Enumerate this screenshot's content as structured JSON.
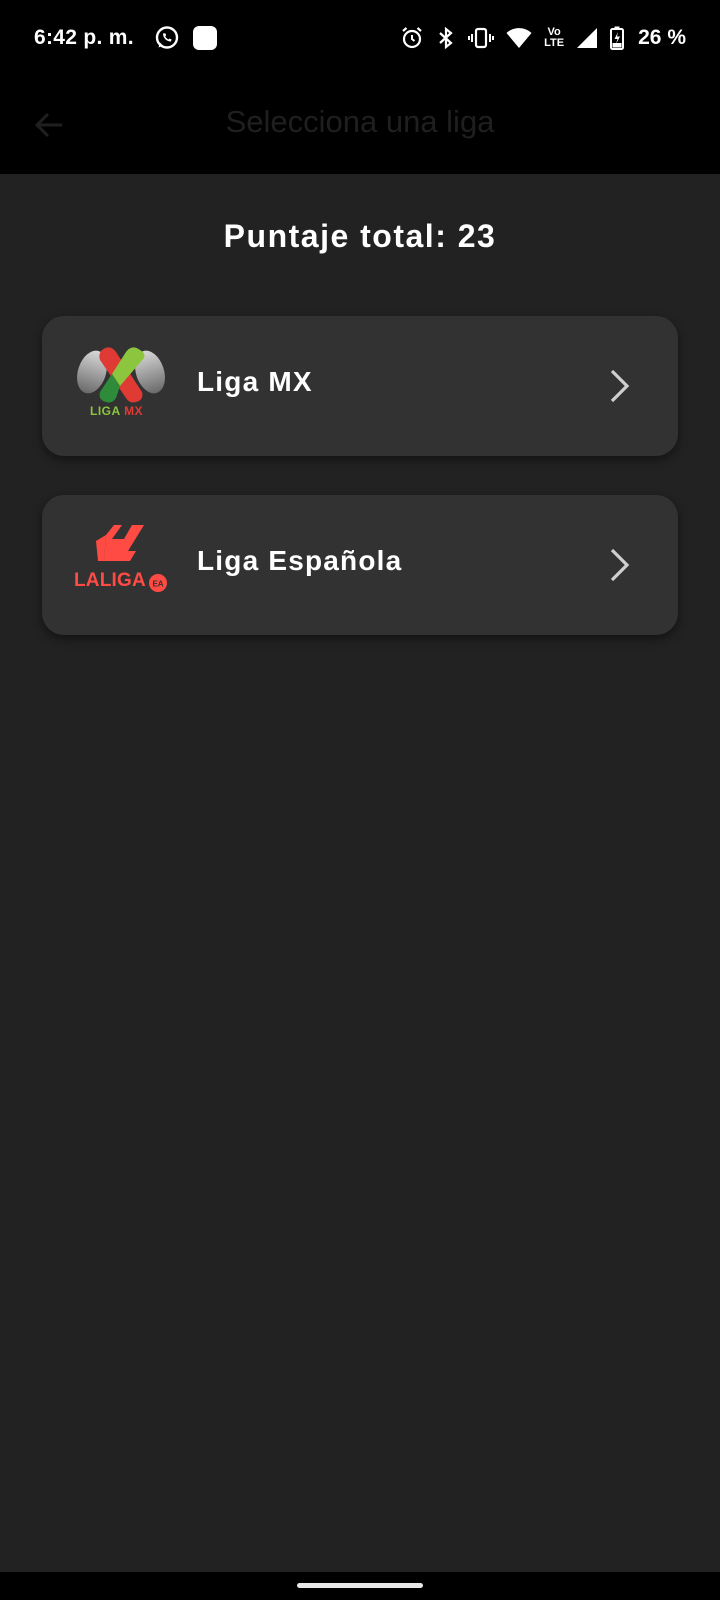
{
  "status_bar": {
    "time": "6:42 p. m.",
    "battery": "26 %",
    "icons": [
      "whatsapp-icon",
      "notification-square-icon",
      "alarm-icon",
      "bluetooth-icon",
      "vibrate-icon",
      "wifi-icon",
      "volte-icon",
      "signal-icon",
      "battery-charging-icon"
    ],
    "volte_top": "Vo",
    "volte_bottom": "LTE"
  },
  "app_bar": {
    "title": "Selecciona una liga",
    "back_icon": "arrow-left-icon"
  },
  "score": {
    "text": "Puntaje total: 23"
  },
  "leagues": [
    {
      "name": "Liga MX",
      "logo": "liga-mx-logo",
      "logo_text": "LIGA MX",
      "chevron_icon": "chevron-right-icon"
    },
    {
      "name": "Liga Española",
      "logo": "laliga-logo",
      "logo_text": "LALIGA",
      "chevron_icon": "chevron-right-icon"
    }
  ],
  "colors": {
    "background": "#222222",
    "card": "#323232",
    "bars": "#000000",
    "text": "#ffffff",
    "laliga_red": "#ff4b44"
  }
}
